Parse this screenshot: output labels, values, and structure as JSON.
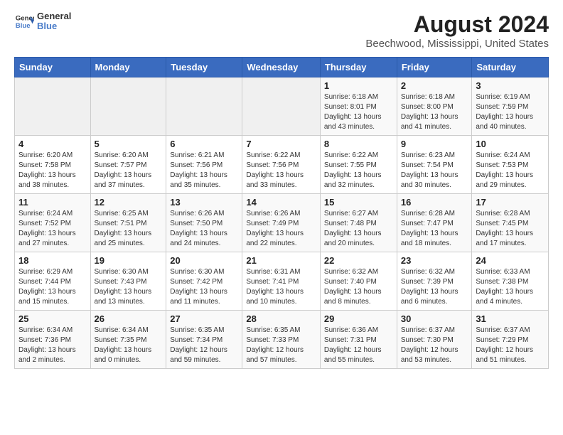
{
  "header": {
    "logo_line1": "General",
    "logo_line2": "Blue",
    "title": "August 2024",
    "subtitle": "Beechwood, Mississippi, United States"
  },
  "weekdays": [
    "Sunday",
    "Monday",
    "Tuesday",
    "Wednesday",
    "Thursday",
    "Friday",
    "Saturday"
  ],
  "weeks": [
    [
      {
        "day": "",
        "detail": ""
      },
      {
        "day": "",
        "detail": ""
      },
      {
        "day": "",
        "detail": ""
      },
      {
        "day": "",
        "detail": ""
      },
      {
        "day": "1",
        "detail": "Sunrise: 6:18 AM\nSunset: 8:01 PM\nDaylight: 13 hours\nand 43 minutes."
      },
      {
        "day": "2",
        "detail": "Sunrise: 6:18 AM\nSunset: 8:00 PM\nDaylight: 13 hours\nand 41 minutes."
      },
      {
        "day": "3",
        "detail": "Sunrise: 6:19 AM\nSunset: 7:59 PM\nDaylight: 13 hours\nand 40 minutes."
      }
    ],
    [
      {
        "day": "4",
        "detail": "Sunrise: 6:20 AM\nSunset: 7:58 PM\nDaylight: 13 hours\nand 38 minutes."
      },
      {
        "day": "5",
        "detail": "Sunrise: 6:20 AM\nSunset: 7:57 PM\nDaylight: 13 hours\nand 37 minutes."
      },
      {
        "day": "6",
        "detail": "Sunrise: 6:21 AM\nSunset: 7:56 PM\nDaylight: 13 hours\nand 35 minutes."
      },
      {
        "day": "7",
        "detail": "Sunrise: 6:22 AM\nSunset: 7:56 PM\nDaylight: 13 hours\nand 33 minutes."
      },
      {
        "day": "8",
        "detail": "Sunrise: 6:22 AM\nSunset: 7:55 PM\nDaylight: 13 hours\nand 32 minutes."
      },
      {
        "day": "9",
        "detail": "Sunrise: 6:23 AM\nSunset: 7:54 PM\nDaylight: 13 hours\nand 30 minutes."
      },
      {
        "day": "10",
        "detail": "Sunrise: 6:24 AM\nSunset: 7:53 PM\nDaylight: 13 hours\nand 29 minutes."
      }
    ],
    [
      {
        "day": "11",
        "detail": "Sunrise: 6:24 AM\nSunset: 7:52 PM\nDaylight: 13 hours\nand 27 minutes."
      },
      {
        "day": "12",
        "detail": "Sunrise: 6:25 AM\nSunset: 7:51 PM\nDaylight: 13 hours\nand 25 minutes."
      },
      {
        "day": "13",
        "detail": "Sunrise: 6:26 AM\nSunset: 7:50 PM\nDaylight: 13 hours\nand 24 minutes."
      },
      {
        "day": "14",
        "detail": "Sunrise: 6:26 AM\nSunset: 7:49 PM\nDaylight: 13 hours\nand 22 minutes."
      },
      {
        "day": "15",
        "detail": "Sunrise: 6:27 AM\nSunset: 7:48 PM\nDaylight: 13 hours\nand 20 minutes."
      },
      {
        "day": "16",
        "detail": "Sunrise: 6:28 AM\nSunset: 7:47 PM\nDaylight: 13 hours\nand 18 minutes."
      },
      {
        "day": "17",
        "detail": "Sunrise: 6:28 AM\nSunset: 7:45 PM\nDaylight: 13 hours\nand 17 minutes."
      }
    ],
    [
      {
        "day": "18",
        "detail": "Sunrise: 6:29 AM\nSunset: 7:44 PM\nDaylight: 13 hours\nand 15 minutes."
      },
      {
        "day": "19",
        "detail": "Sunrise: 6:30 AM\nSunset: 7:43 PM\nDaylight: 13 hours\nand 13 minutes."
      },
      {
        "day": "20",
        "detail": "Sunrise: 6:30 AM\nSunset: 7:42 PM\nDaylight: 13 hours\nand 11 minutes."
      },
      {
        "day": "21",
        "detail": "Sunrise: 6:31 AM\nSunset: 7:41 PM\nDaylight: 13 hours\nand 10 minutes."
      },
      {
        "day": "22",
        "detail": "Sunrise: 6:32 AM\nSunset: 7:40 PM\nDaylight: 13 hours\nand 8 minutes."
      },
      {
        "day": "23",
        "detail": "Sunrise: 6:32 AM\nSunset: 7:39 PM\nDaylight: 13 hours\nand 6 minutes."
      },
      {
        "day": "24",
        "detail": "Sunrise: 6:33 AM\nSunset: 7:38 PM\nDaylight: 13 hours\nand 4 minutes."
      }
    ],
    [
      {
        "day": "25",
        "detail": "Sunrise: 6:34 AM\nSunset: 7:36 PM\nDaylight: 13 hours\nand 2 minutes."
      },
      {
        "day": "26",
        "detail": "Sunrise: 6:34 AM\nSunset: 7:35 PM\nDaylight: 13 hours\nand 0 minutes."
      },
      {
        "day": "27",
        "detail": "Sunrise: 6:35 AM\nSunset: 7:34 PM\nDaylight: 12 hours\nand 59 minutes."
      },
      {
        "day": "28",
        "detail": "Sunrise: 6:35 AM\nSunset: 7:33 PM\nDaylight: 12 hours\nand 57 minutes."
      },
      {
        "day": "29",
        "detail": "Sunrise: 6:36 AM\nSunset: 7:31 PM\nDaylight: 12 hours\nand 55 minutes."
      },
      {
        "day": "30",
        "detail": "Sunrise: 6:37 AM\nSunset: 7:30 PM\nDaylight: 12 hours\nand 53 minutes."
      },
      {
        "day": "31",
        "detail": "Sunrise: 6:37 AM\nSunset: 7:29 PM\nDaylight: 12 hours\nand 51 minutes."
      }
    ]
  ]
}
